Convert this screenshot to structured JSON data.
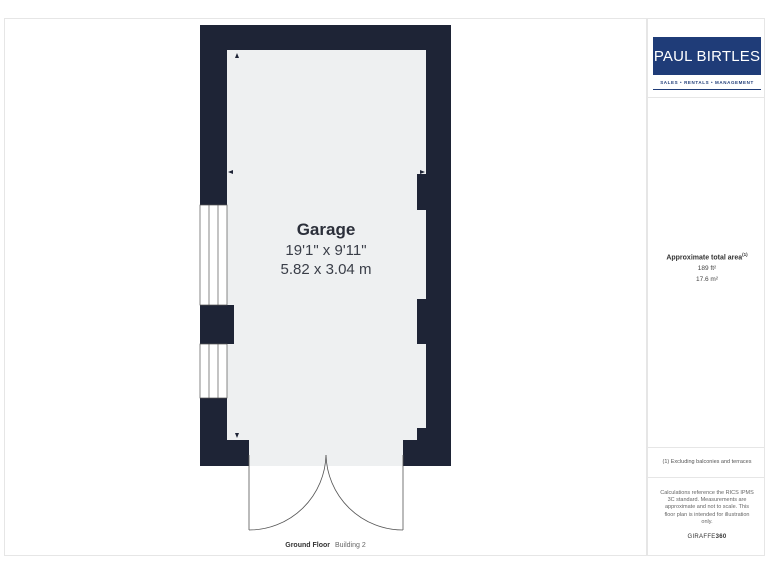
{
  "brand": {
    "name": "PAUL BIRTLES",
    "tagline": "SALES • RENTALS • MANAGEMENT",
    "color": "#1f3c78"
  },
  "summary": {
    "title": "Approximate total area",
    "title_superscript": "(1)",
    "sqft": "189 ft²",
    "sqm": "17.6 m²",
    "exclusion_note": "(1) Excluding balconies and terraces",
    "calc_note": "Calculations reference the RICS IPMS 3C standard. Measurements are approximate and not to scale. This floor plan is intended for illustration only.",
    "software_prefix": "GIRAFFE",
    "software_suffix": "360"
  },
  "floor": {
    "name": "Ground Floor",
    "building": "Building 2"
  },
  "room": {
    "name": "Garage",
    "dim_imperial": "19'1\" x 9'11\"",
    "dim_metric": "5.82 x 3.04 m"
  },
  "colors": {
    "wall": "#1e2436",
    "floor": "#eef0f1",
    "line": "#555555"
  }
}
